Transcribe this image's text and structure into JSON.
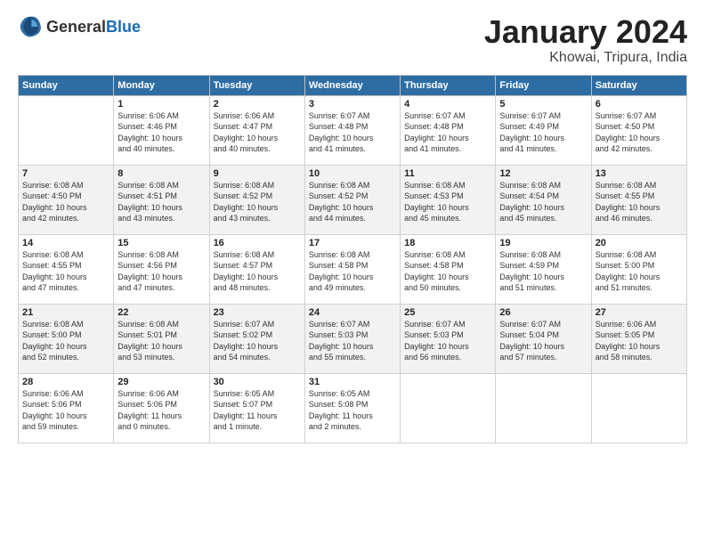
{
  "logo": {
    "general": "General",
    "blue": "Blue"
  },
  "title": "January 2024",
  "subtitle": "Khowai, Tripura, India",
  "headers": [
    "Sunday",
    "Monday",
    "Tuesday",
    "Wednesday",
    "Thursday",
    "Friday",
    "Saturday"
  ],
  "weeks": [
    [
      {
        "day": "",
        "info": ""
      },
      {
        "day": "1",
        "info": "Sunrise: 6:06 AM\nSunset: 4:46 PM\nDaylight: 10 hours\nand 40 minutes."
      },
      {
        "day": "2",
        "info": "Sunrise: 6:06 AM\nSunset: 4:47 PM\nDaylight: 10 hours\nand 40 minutes."
      },
      {
        "day": "3",
        "info": "Sunrise: 6:07 AM\nSunset: 4:48 PM\nDaylight: 10 hours\nand 41 minutes."
      },
      {
        "day": "4",
        "info": "Sunrise: 6:07 AM\nSunset: 4:48 PM\nDaylight: 10 hours\nand 41 minutes."
      },
      {
        "day": "5",
        "info": "Sunrise: 6:07 AM\nSunset: 4:49 PM\nDaylight: 10 hours\nand 41 minutes."
      },
      {
        "day": "6",
        "info": "Sunrise: 6:07 AM\nSunset: 4:50 PM\nDaylight: 10 hours\nand 42 minutes."
      }
    ],
    [
      {
        "day": "7",
        "info": "Sunrise: 6:08 AM\nSunset: 4:50 PM\nDaylight: 10 hours\nand 42 minutes."
      },
      {
        "day": "8",
        "info": "Sunrise: 6:08 AM\nSunset: 4:51 PM\nDaylight: 10 hours\nand 43 minutes."
      },
      {
        "day": "9",
        "info": "Sunrise: 6:08 AM\nSunset: 4:52 PM\nDaylight: 10 hours\nand 43 minutes."
      },
      {
        "day": "10",
        "info": "Sunrise: 6:08 AM\nSunset: 4:52 PM\nDaylight: 10 hours\nand 44 minutes."
      },
      {
        "day": "11",
        "info": "Sunrise: 6:08 AM\nSunset: 4:53 PM\nDaylight: 10 hours\nand 45 minutes."
      },
      {
        "day": "12",
        "info": "Sunrise: 6:08 AM\nSunset: 4:54 PM\nDaylight: 10 hours\nand 45 minutes."
      },
      {
        "day": "13",
        "info": "Sunrise: 6:08 AM\nSunset: 4:55 PM\nDaylight: 10 hours\nand 46 minutes."
      }
    ],
    [
      {
        "day": "14",
        "info": "Sunrise: 6:08 AM\nSunset: 4:55 PM\nDaylight: 10 hours\nand 47 minutes."
      },
      {
        "day": "15",
        "info": "Sunrise: 6:08 AM\nSunset: 4:56 PM\nDaylight: 10 hours\nand 47 minutes."
      },
      {
        "day": "16",
        "info": "Sunrise: 6:08 AM\nSunset: 4:57 PM\nDaylight: 10 hours\nand 48 minutes."
      },
      {
        "day": "17",
        "info": "Sunrise: 6:08 AM\nSunset: 4:58 PM\nDaylight: 10 hours\nand 49 minutes."
      },
      {
        "day": "18",
        "info": "Sunrise: 6:08 AM\nSunset: 4:58 PM\nDaylight: 10 hours\nand 50 minutes."
      },
      {
        "day": "19",
        "info": "Sunrise: 6:08 AM\nSunset: 4:59 PM\nDaylight: 10 hours\nand 51 minutes."
      },
      {
        "day": "20",
        "info": "Sunrise: 6:08 AM\nSunset: 5:00 PM\nDaylight: 10 hours\nand 51 minutes."
      }
    ],
    [
      {
        "day": "21",
        "info": "Sunrise: 6:08 AM\nSunset: 5:00 PM\nDaylight: 10 hours\nand 52 minutes."
      },
      {
        "day": "22",
        "info": "Sunrise: 6:08 AM\nSunset: 5:01 PM\nDaylight: 10 hours\nand 53 minutes."
      },
      {
        "day": "23",
        "info": "Sunrise: 6:07 AM\nSunset: 5:02 PM\nDaylight: 10 hours\nand 54 minutes."
      },
      {
        "day": "24",
        "info": "Sunrise: 6:07 AM\nSunset: 5:03 PM\nDaylight: 10 hours\nand 55 minutes."
      },
      {
        "day": "25",
        "info": "Sunrise: 6:07 AM\nSunset: 5:03 PM\nDaylight: 10 hours\nand 56 minutes."
      },
      {
        "day": "26",
        "info": "Sunrise: 6:07 AM\nSunset: 5:04 PM\nDaylight: 10 hours\nand 57 minutes."
      },
      {
        "day": "27",
        "info": "Sunrise: 6:06 AM\nSunset: 5:05 PM\nDaylight: 10 hours\nand 58 minutes."
      }
    ],
    [
      {
        "day": "28",
        "info": "Sunrise: 6:06 AM\nSunset: 5:06 PM\nDaylight: 10 hours\nand 59 minutes."
      },
      {
        "day": "29",
        "info": "Sunrise: 6:06 AM\nSunset: 5:06 PM\nDaylight: 11 hours\nand 0 minutes."
      },
      {
        "day": "30",
        "info": "Sunrise: 6:05 AM\nSunset: 5:07 PM\nDaylight: 11 hours\nand 1 minute."
      },
      {
        "day": "31",
        "info": "Sunrise: 6:05 AM\nSunset: 5:08 PM\nDaylight: 11 hours\nand 2 minutes."
      },
      {
        "day": "",
        "info": ""
      },
      {
        "day": "",
        "info": ""
      },
      {
        "day": "",
        "info": ""
      }
    ]
  ]
}
